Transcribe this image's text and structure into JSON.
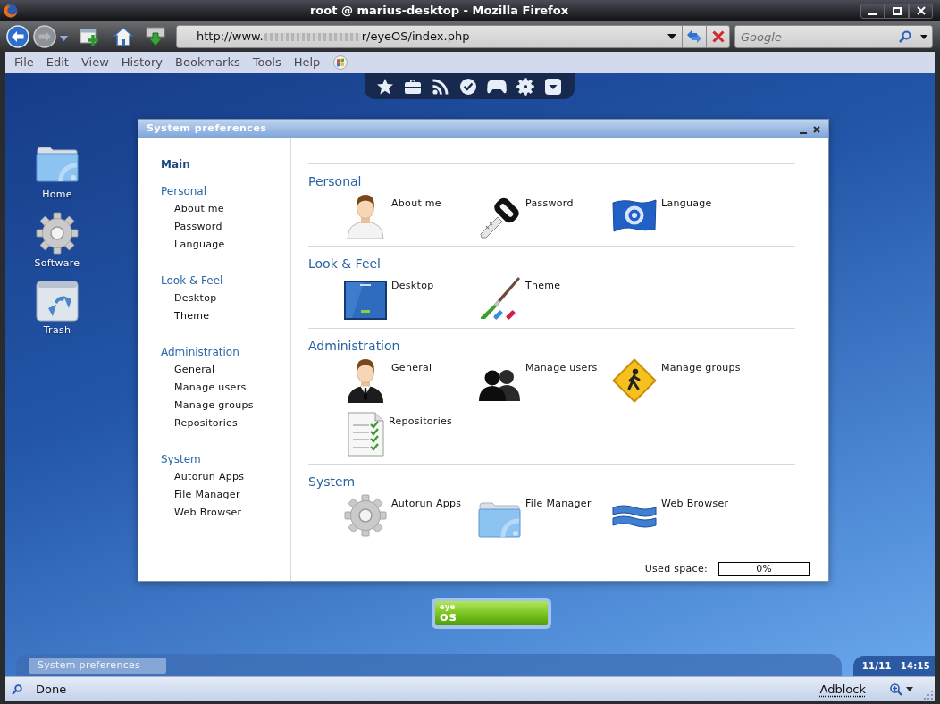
{
  "browser": {
    "title": "root @ marius-desktop - Mozilla Firefox",
    "url": {
      "start": "http://www.",
      "end": "r/eyeOS/index.php"
    },
    "search": {
      "placeholder": "Google"
    },
    "menu": [
      "File",
      "Edit",
      "View",
      "History",
      "Bookmarks",
      "Tools",
      "Help"
    ]
  },
  "desktop": {
    "icons": [
      {
        "label": "Home",
        "kind": "folder"
      },
      {
        "label": "Software",
        "kind": "gear"
      },
      {
        "label": "Trash",
        "kind": "recycle"
      }
    ]
  },
  "window": {
    "title": "System preferences",
    "nav": {
      "main": "Main",
      "groups": [
        {
          "title": "Personal",
          "items": [
            "About me",
            "Password",
            "Language"
          ]
        },
        {
          "title": "Look & Feel",
          "items": [
            "Desktop",
            "Theme"
          ]
        },
        {
          "title": "Administration",
          "items": [
            "General",
            "Manage users",
            "Manage groups",
            "Repositories"
          ]
        },
        {
          "title": "System",
          "items": [
            "Autorun Apps",
            "File Manager",
            "Web Browser"
          ]
        }
      ]
    },
    "sections": [
      {
        "title": "Personal",
        "items": [
          {
            "label": "About me",
            "kind": "person"
          },
          {
            "label": "Password",
            "kind": "key"
          },
          {
            "label": "Language",
            "kind": "flag"
          }
        ]
      },
      {
        "title": "Look & Feel",
        "items": [
          {
            "label": "Desktop",
            "kind": "screen"
          },
          {
            "label": "Theme",
            "kind": "brush"
          }
        ]
      },
      {
        "title": "Administration",
        "items": [
          {
            "label": "General",
            "kind": "suit"
          },
          {
            "label": "Manage users",
            "kind": "users"
          },
          {
            "label": "Manage groups",
            "kind": "sign"
          },
          {
            "label": "Repositories",
            "kind": "checklist"
          }
        ]
      },
      {
        "title": "System",
        "items": [
          {
            "label": "Autorun Apps",
            "kind": "gear"
          },
          {
            "label": "File Manager",
            "kind": "folder"
          },
          {
            "label": "Web Browser",
            "kind": "waves"
          }
        ]
      }
    ],
    "used_space": {
      "label": "Used space:",
      "reading": "0%",
      "level": 0
    }
  },
  "launcher": {
    "top": "eye",
    "bottom": "os"
  },
  "taskbar": {
    "tasks": [
      {
        "label": "System preferences"
      }
    ],
    "date": "11/11",
    "time": "14:15"
  },
  "status_bar": {
    "text": "Done",
    "addon": "Adblock"
  }
}
